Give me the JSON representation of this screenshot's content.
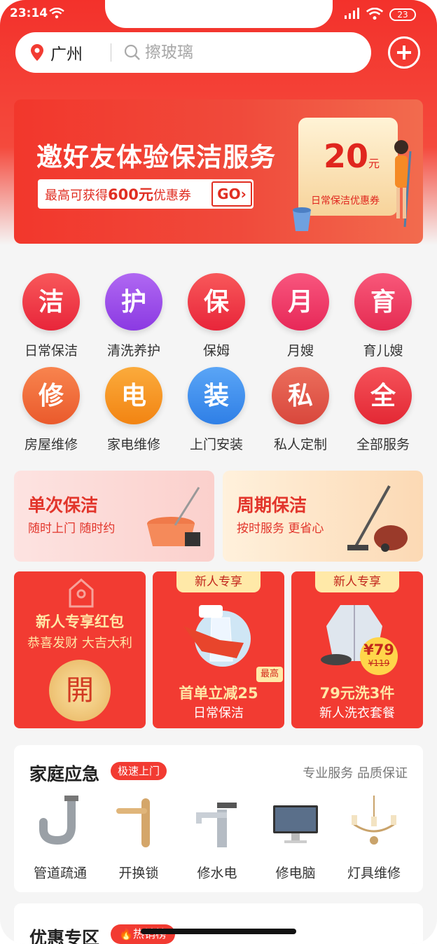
{
  "status": {
    "time": "23:14",
    "battery": "23"
  },
  "header": {
    "city": "广州",
    "search_placeholder": "擦玻璃"
  },
  "banner": {
    "title": "邀好友体验保洁服务",
    "subtitle_prefix": "最高可获得",
    "subtitle_amount": "600元",
    "subtitle_suffix": "优惠券",
    "go_label": "GO",
    "coupon_amount": "20",
    "coupon_unit": "元",
    "coupon_label": "日常保洁优惠券"
  },
  "services": [
    {
      "glyph": "洁",
      "label": "日常保洁",
      "color": "#f0383a"
    },
    {
      "glyph": "护",
      "label": "清洗养护",
      "color": "#9b47e8"
    },
    {
      "glyph": "保",
      "label": "保姆",
      "color": "#f0383a"
    },
    {
      "glyph": "月",
      "label": "月嫂",
      "color": "#f0386b"
    },
    {
      "glyph": "育",
      "label": "育儿嫂",
      "color": "#f04268"
    },
    {
      "glyph": "修",
      "label": "房屋维修",
      "color": "#f26a3c"
    },
    {
      "glyph": "电",
      "label": "家电维修",
      "color": "#f7941e"
    },
    {
      "glyph": "装",
      "label": "上门安装",
      "color": "#3d8ff0"
    },
    {
      "glyph": "私",
      "label": "私人定制",
      "color": "#e4544a"
    },
    {
      "glyph": "全",
      "label": "全部服务",
      "color": "#ea3540"
    }
  ],
  "clean_cards": [
    {
      "title": "单次保洁",
      "subtitle": "随时上门 随时约"
    },
    {
      "title": "周期保洁",
      "subtitle": "按时服务 更省心"
    }
  ],
  "promos": {
    "red_packet": {
      "title": "新人专享红包",
      "subtitle": "恭喜发财 大吉大利",
      "button": "開"
    },
    "cleaning": {
      "tab": "新人专享",
      "badge": "最高",
      "title": "首单立减25",
      "subtitle": "日常保洁"
    },
    "laundry": {
      "tab": "新人专享",
      "price": "¥79",
      "old_price": "¥119",
      "title": "79元洗3件",
      "subtitle": "新人洗衣套餐"
    }
  },
  "emergency": {
    "title": "家庭应急",
    "badge": "极速上门",
    "tagline": "专业服务 品质保证",
    "items": [
      {
        "label": "管道疏通",
        "icon": "pipe-icon"
      },
      {
        "label": "开换锁",
        "icon": "door-handle-icon"
      },
      {
        "label": "修水电",
        "icon": "faucet-icon"
      },
      {
        "label": "修电脑",
        "icon": "computer-icon"
      },
      {
        "label": "灯具维修",
        "icon": "chandelier-icon"
      }
    ]
  },
  "deals": {
    "title": "优惠专区",
    "badge": "热销榜"
  }
}
